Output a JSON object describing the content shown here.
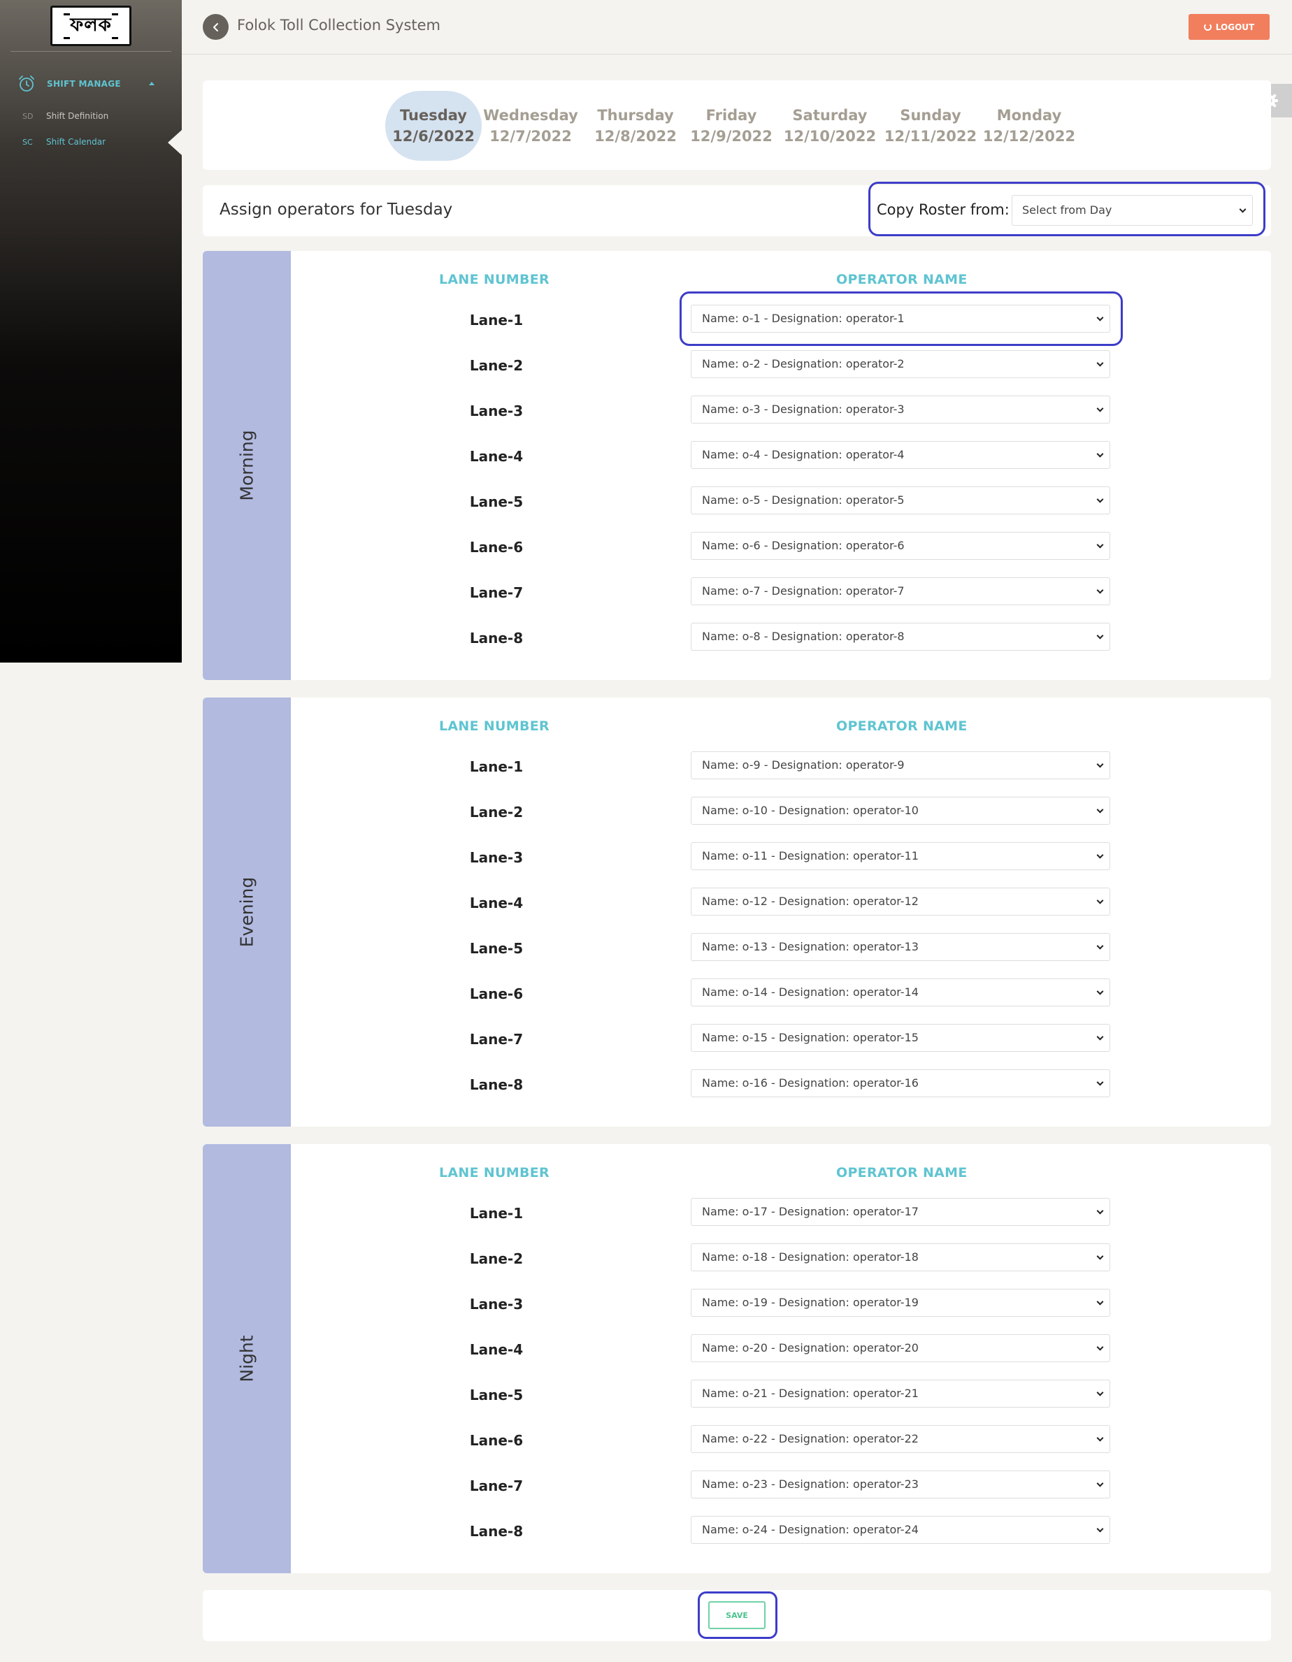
{
  "sidebar": {
    "logo_text": "ফলক",
    "section_label": "SHIFT MANAGE",
    "items": [
      {
        "abbr": "SD",
        "label": "Shift Definition"
      },
      {
        "abbr": "SC",
        "label": "Shift Calendar"
      }
    ]
  },
  "header": {
    "title": "Folok Toll Collection System",
    "logout_label": "LOGOUT"
  },
  "days": [
    {
      "name": "Tuesday",
      "date": "12/6/2022",
      "active": true
    },
    {
      "name": "Wednesday",
      "date": "12/7/2022"
    },
    {
      "name": "Thursday",
      "date": "12/8/2022"
    },
    {
      "name": "Friday",
      "date": "12/9/2022"
    },
    {
      "name": "Saturday",
      "date": "12/10/2022"
    },
    {
      "name": "Sunday",
      "date": "12/11/2022"
    },
    {
      "name": "Monday",
      "date": "12/12/2022"
    }
  ],
  "assign": {
    "title": "Assign operators for Tuesday",
    "copy_label": "Copy Roster from:",
    "copy_value": "Select from Day"
  },
  "columns": {
    "lane": "LANE NUMBER",
    "operator": "OPERATOR NAME"
  },
  "shifts": [
    {
      "name": "Morning",
      "rows": [
        {
          "lane": "Lane-1",
          "operator": "Name: o-1 - Designation: operator-1"
        },
        {
          "lane": "Lane-2",
          "operator": "Name: o-2 - Designation: operator-2"
        },
        {
          "lane": "Lane-3",
          "operator": "Name: o-3 - Designation: operator-3"
        },
        {
          "lane": "Lane-4",
          "operator": "Name: o-4 - Designation: operator-4"
        },
        {
          "lane": "Lane-5",
          "operator": "Name: o-5 - Designation: operator-5"
        },
        {
          "lane": "Lane-6",
          "operator": "Name: o-6 - Designation: operator-6"
        },
        {
          "lane": "Lane-7",
          "operator": "Name: o-7 - Designation: operator-7"
        },
        {
          "lane": "Lane-8",
          "operator": "Name: o-8 - Designation: operator-8"
        }
      ]
    },
    {
      "name": "Evening",
      "rows": [
        {
          "lane": "Lane-1",
          "operator": "Name: o-9 - Designation: operator-9"
        },
        {
          "lane": "Lane-2",
          "operator": "Name: o-10 - Designation: operator-10"
        },
        {
          "lane": "Lane-3",
          "operator": "Name: o-11 - Designation: operator-11"
        },
        {
          "lane": "Lane-4",
          "operator": "Name: o-12 - Designation: operator-12"
        },
        {
          "lane": "Lane-5",
          "operator": "Name: o-13 - Designation: operator-13"
        },
        {
          "lane": "Lane-6",
          "operator": "Name: o-14 - Designation: operator-14"
        },
        {
          "lane": "Lane-7",
          "operator": "Name: o-15 - Designation: operator-15"
        },
        {
          "lane": "Lane-8",
          "operator": "Name: o-16 - Designation: operator-16"
        }
      ]
    },
    {
      "name": "Night",
      "rows": [
        {
          "lane": "Lane-1",
          "operator": "Name: o-17 - Designation: operator-17"
        },
        {
          "lane": "Lane-2",
          "operator": "Name: o-18 - Designation: operator-18"
        },
        {
          "lane": "Lane-3",
          "operator": "Name: o-19 - Designation: operator-19"
        },
        {
          "lane": "Lane-4",
          "operator": "Name: o-20 - Designation: operator-20"
        },
        {
          "lane": "Lane-5",
          "operator": "Name: o-21 - Designation: operator-21"
        },
        {
          "lane": "Lane-6",
          "operator": "Name: o-22 - Designation: operator-22"
        },
        {
          "lane": "Lane-7",
          "operator": "Name: o-23 - Designation: operator-23"
        },
        {
          "lane": "Lane-8",
          "operator": "Name: o-24 - Designation: operator-24"
        }
      ]
    }
  ],
  "save_label": "SAVE",
  "colors": {
    "accent": "#5fc4d1",
    "logout": "#f17e5d",
    "shift_band": "#b2bae0",
    "highlight": "#3d3dc8"
  }
}
